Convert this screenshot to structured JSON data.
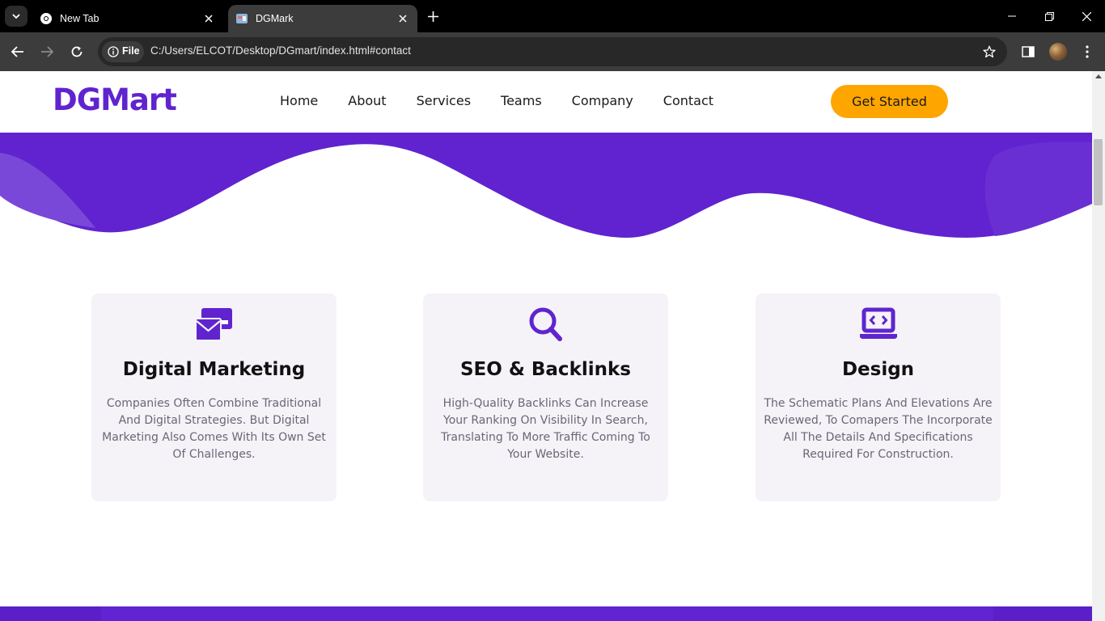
{
  "browser": {
    "tabs": [
      {
        "title": "New Tab",
        "active": false
      },
      {
        "title": "DGMark",
        "active": true
      }
    ],
    "url_chip": "File",
    "url": "C:/Users/ELCOT/Desktop/DGmart/index.html#contact"
  },
  "site": {
    "logo": "DGMart",
    "nav": [
      "Home",
      "About",
      "Services",
      "Teams",
      "Company",
      "Contact"
    ],
    "cta": "Get Started",
    "colors": {
      "brand": "#6024cf",
      "cta": "#ffa500",
      "card_bg": "#f5f3f8"
    }
  },
  "services": [
    {
      "icon": "envelope-card-icon",
      "title": "Digital Marketing",
      "desc": "Companies Often Combine Traditional And Digital Strategies. But Digital Marketing Also Comes With Its Own Set Of Challenges."
    },
    {
      "icon": "search-icon",
      "title": "SEO & Backlinks",
      "desc": "High-Quality Backlinks Can Increase Your Ranking On Visibility In Search, Translating To More Traffic Coming To Your Website."
    },
    {
      "icon": "laptop-code-icon",
      "title": "Design",
      "desc": "The Schematic Plans And Elevations Are Reviewed, To Comapers The Incorporate All The Details And Specifications Required For Construction."
    }
  ]
}
